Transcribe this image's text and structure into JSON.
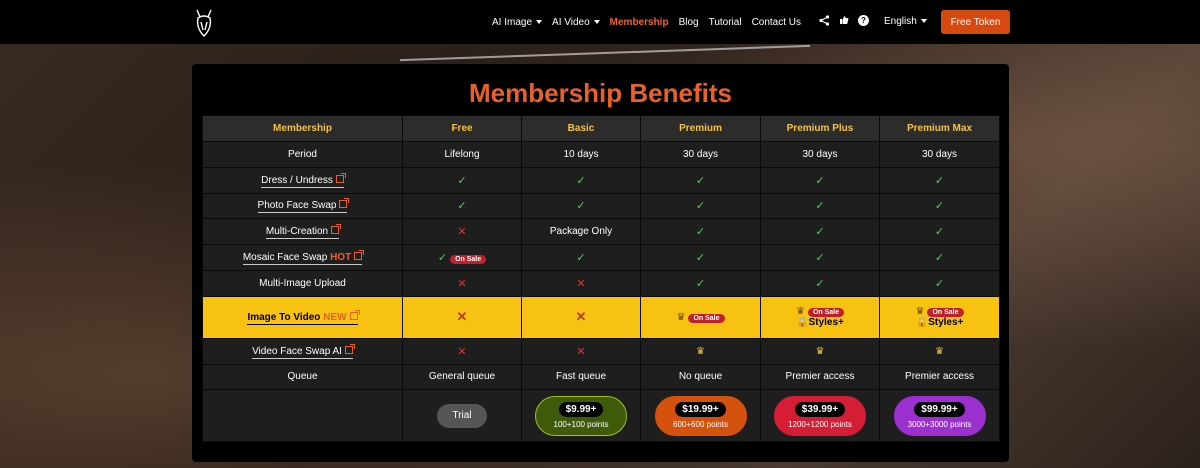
{
  "nav": {
    "items": [
      {
        "label": "AI Image",
        "dropdown": true
      },
      {
        "label": "AI Video",
        "dropdown": true
      },
      {
        "label": "Membership",
        "active": true
      },
      {
        "label": "Blog"
      },
      {
        "label": "Tutorial"
      },
      {
        "label": "Contact Us"
      }
    ],
    "language": "English",
    "token_button": "Free Token",
    "icons": [
      "share-icon",
      "thumbs-up-icon",
      "help-icon"
    ]
  },
  "page": {
    "title": "Membership Benefits"
  },
  "table": {
    "headers": [
      "Membership",
      "Free",
      "Basic",
      "Premium",
      "Premium Plus",
      "Premium Max"
    ],
    "period": {
      "label": "Period",
      "values": [
        "Lifelong",
        "10 days",
        "30 days",
        "30 days",
        "30 days"
      ]
    },
    "features": [
      {
        "label": "Dress / Undress",
        "link": true,
        "cells": [
          "check",
          "check",
          "check",
          "check",
          "check"
        ]
      },
      {
        "label": "Photo Face Swap",
        "link": true,
        "cells": [
          "check",
          "check",
          "check",
          "check",
          "check"
        ]
      },
      {
        "label": "Multi-Creation",
        "link": true,
        "cells": [
          "cross",
          "Package Only",
          "check",
          "check",
          "check"
        ]
      },
      {
        "label": "Mosaic Face Swap",
        "badge": "HOT",
        "link": true,
        "cells": [
          "check-sale",
          "check",
          "check",
          "check",
          "check"
        ]
      },
      {
        "label": "Multi-Image Upload",
        "link": false,
        "cells": [
          "cross",
          "cross",
          "check",
          "check",
          "check"
        ]
      }
    ],
    "highlight": {
      "label": "Image To Video",
      "badge": "NEW",
      "cells": [
        "cross",
        "cross",
        "crown-sale",
        "crown-sale-styles",
        "crown-sale-styles"
      ]
    },
    "video_face_swap": {
      "label": "Video Face Swap AI",
      "cells": [
        "cross",
        "cross",
        "crown",
        "crown",
        "crown"
      ]
    },
    "queue": {
      "label": "Queue",
      "values": [
        "General queue",
        "Fast queue",
        "No queue",
        "Premier access",
        "Premier access"
      ]
    },
    "sale_label": "On Sale",
    "styles_label": "Styles+",
    "prices": {
      "trial": "Trial",
      "plans": [
        {
          "price": "$9.99+",
          "points": "100+100 points",
          "color": "#3e5a0a",
          "border": "#9ec21d"
        },
        {
          "price": "$19.99+",
          "points": "600+600 points",
          "color": "#d4520d",
          "border": "#d4520d"
        },
        {
          "price": "$39.99+",
          "points": "1200+1200 points",
          "color": "#d51e35",
          "border": "#d51e35"
        },
        {
          "price": "$99.99+",
          "points": "3000+3000 points",
          "color": "#9b2fd0",
          "border": "#9b2fd0"
        }
      ]
    }
  },
  "colors": {
    "accent": "#e8602a",
    "highlight": "#f8c213",
    "check": "#4fd05a",
    "cross": "#e0342a"
  }
}
